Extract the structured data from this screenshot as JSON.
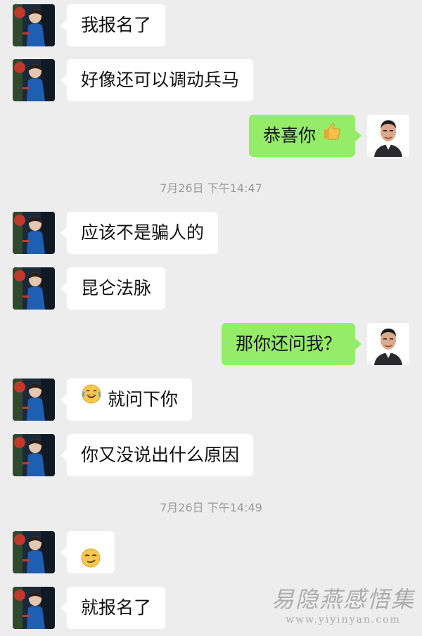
{
  "conversation": {
    "messages": [
      {
        "side": "left",
        "text": "我报名了"
      },
      {
        "side": "left",
        "text": "好像还可以调动兵马"
      },
      {
        "side": "right",
        "text": "恭喜你",
        "emoji": "thumbs-up"
      },
      {
        "timestamp": "7月26日 下午14:47"
      },
      {
        "side": "left",
        "text": "应该不是骗人的"
      },
      {
        "side": "left",
        "text": "昆仑法脉"
      },
      {
        "side": "right",
        "text": "那你还问我？"
      },
      {
        "side": "left",
        "text": "就问下你",
        "emoji": "laughing-tears"
      },
      {
        "side": "left",
        "text": "你又没说出什么原因"
      },
      {
        "timestamp": "7月26日 下午14:49"
      },
      {
        "side": "left",
        "text": "",
        "emoji": "smirk"
      },
      {
        "side": "left",
        "text": "就报名了"
      }
    ]
  },
  "watermark": {
    "title": "易隐燕感悟集",
    "url": "www.yiyinyan.com"
  },
  "colors": {
    "background": "#ededed",
    "bubble_self": "#95ec69",
    "bubble_other": "#ffffff",
    "timestamp_text": "#9a9a9a"
  },
  "icons": {
    "contact_avatar": "woman-in-blue-avatar",
    "self_avatar": "man-portrait-avatar"
  }
}
